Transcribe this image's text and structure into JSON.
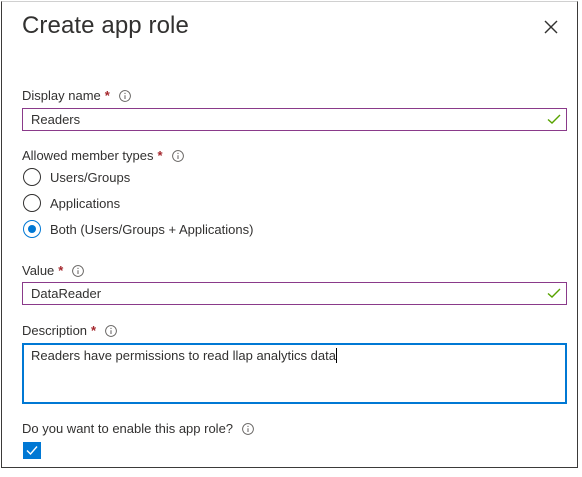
{
  "dialog": {
    "title": "Create app role",
    "close_icon": "close-icon"
  },
  "display_name": {
    "label": "Display name",
    "required_marker": "*",
    "value": "Readers",
    "valid": true
  },
  "member_types": {
    "label": "Allowed member types",
    "required_marker": "*",
    "options": [
      {
        "label": "Users/Groups",
        "selected": false
      },
      {
        "label": "Applications",
        "selected": false
      },
      {
        "label": "Both (Users/Groups + Applications)",
        "selected": true
      }
    ]
  },
  "value_field": {
    "label": "Value",
    "required_marker": "*",
    "value": "DataReader",
    "valid": true
  },
  "description": {
    "label": "Description",
    "required_marker": "*",
    "value": "Readers have permissions to read llap analytics data"
  },
  "enable": {
    "label": "Do you want to enable this app role?",
    "checked": true
  },
  "colors": {
    "accent": "#0078d4",
    "required": "#a4262c",
    "valid_check": "#57a300",
    "field_border": "#8a3a8a"
  }
}
